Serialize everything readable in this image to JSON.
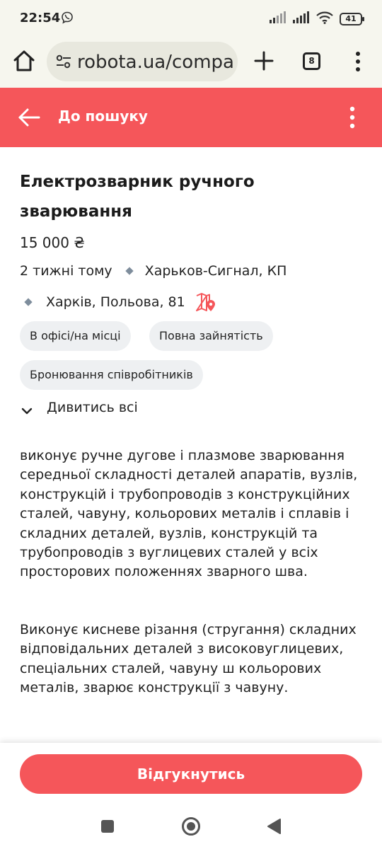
{
  "status_bar": {
    "time": "22:54",
    "battery": "41"
  },
  "browser": {
    "url": "robota.ua/compa",
    "tab_count": "8"
  },
  "header": {
    "back_label": "До пошуку"
  },
  "job": {
    "title": "Електрозварник ручного зварювання",
    "salary": "15 000 ₴",
    "posted": "2 тижні тому",
    "company": "Харьков-Сигнал, КП",
    "address": "Харків, Польова, 81",
    "chips": [
      "В офісі/на місці",
      "Повна зайнятість",
      "Бронювання співробітників"
    ],
    "see_all": "Дивитись всі",
    "description": [
      "виконує ручне дугове і плазмове зварювання середньої складності деталей апаратів, вузлів, конструкцій і трубопроводів з конструкційних сталей, чавуну, кольорових металів і сплавів і складних деталей, вузлів, конструкцій та трубопроводів з вуглицевих сталей у всіх просторових положеннях зварного шва.",
      "Виконує кисневе різання (стругання) складних відповідальних деталей з високовуглицевих, спеціальних сталей, чавуну ш кольорових металів, зварює конструкції з чавуну."
    ]
  },
  "apply_button": "Відгукнутись",
  "colors": {
    "brand": "#f5565a",
    "chip_bg": "#eef0f2",
    "diamond": "#7e8d9c"
  }
}
